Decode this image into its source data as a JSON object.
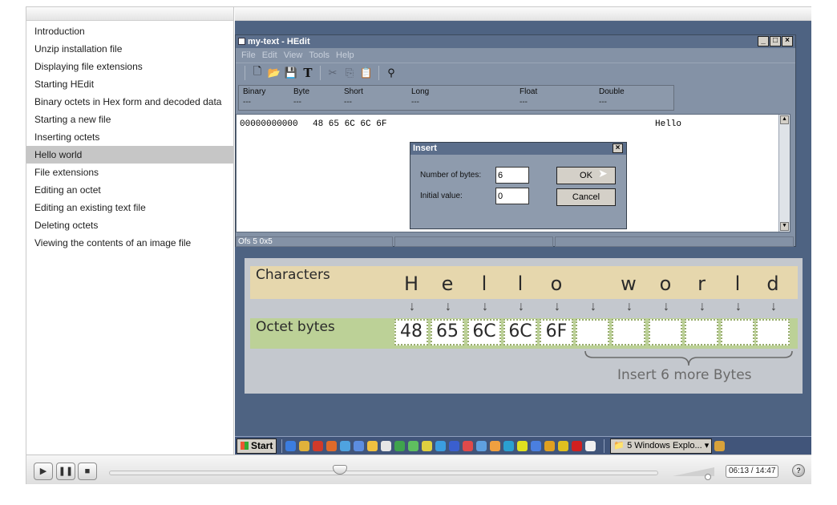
{
  "sidebar": {
    "items": [
      {
        "label": "Introduction"
      },
      {
        "label": "Unzip installation file"
      },
      {
        "label": "Displaying file extensions"
      },
      {
        "label": "Starting HEdit"
      },
      {
        "label": "Binary octets in Hex form and decoded data"
      },
      {
        "label": "Starting a new file"
      },
      {
        "label": "Inserting octets"
      },
      {
        "label": "Hello world",
        "active": true
      },
      {
        "label": "File extensions"
      },
      {
        "label": "Editing an octet"
      },
      {
        "label": "Editing an existing text file"
      },
      {
        "label": "Deleting octets"
      },
      {
        "label": "Viewing the contents of an image file"
      }
    ]
  },
  "hedit": {
    "title": "my-text - HEdit",
    "menu": [
      "File",
      "Edit",
      "View",
      "Tools",
      "Help"
    ],
    "fields": [
      {
        "label": "Binary",
        "value": "---"
      },
      {
        "label": "Byte",
        "value": "---"
      },
      {
        "label": "Short",
        "value": "---"
      },
      {
        "label": "Long",
        "value": "---"
      },
      {
        "label": "Float",
        "value": "---"
      },
      {
        "label": "Double",
        "value": "---"
      }
    ],
    "hex_offset": "00000000000",
    "hex_bytes": "48 65 6C 6C 6F",
    "hex_ascii": "Hello",
    "status": "Ofs 5  0x5"
  },
  "dialog": {
    "title": "Insert",
    "number_label": "Number of bytes:",
    "number_value": "6",
    "initial_label": "Initial value:",
    "initial_value": "0",
    "ok_label": "OK",
    "cancel_label": "Cancel"
  },
  "diagram": {
    "characters_label": "Characters",
    "octets_label": "Octet bytes",
    "characters": [
      "H",
      "e",
      "l",
      "l",
      "o",
      "",
      "w",
      "o",
      "r",
      "l",
      "d"
    ],
    "octets": [
      "48",
      "65",
      "6C",
      "6C",
      "6F",
      "",
      "",
      "",
      "",
      "",
      ""
    ],
    "insert_note": "Insert 6 more Bytes"
  },
  "taskbar": {
    "start_label": "Start",
    "task_label": "5 Windows Explo...",
    "quick_colors": [
      "#3b7de0",
      "#e0b23b",
      "#d13a2a",
      "#e06a2a",
      "#4fa3e0",
      "#5c8de0",
      "#f0c040",
      "#e6e6e6",
      "#3fa34d",
      "#5fbf5f",
      "#e0d040",
      "#3b9de0",
      "#3a5fcf",
      "#e04a4a",
      "#5fa0e0",
      "#f0a040",
      "#2aa0d0",
      "#e0e020",
      "#4a7fe0",
      "#e0a020",
      "#e0c020",
      "#d02020",
      "#f0f0f0"
    ]
  },
  "controls": {
    "time": "06:13 / 14:47",
    "progress": 0.42,
    "volume": 0.85
  }
}
